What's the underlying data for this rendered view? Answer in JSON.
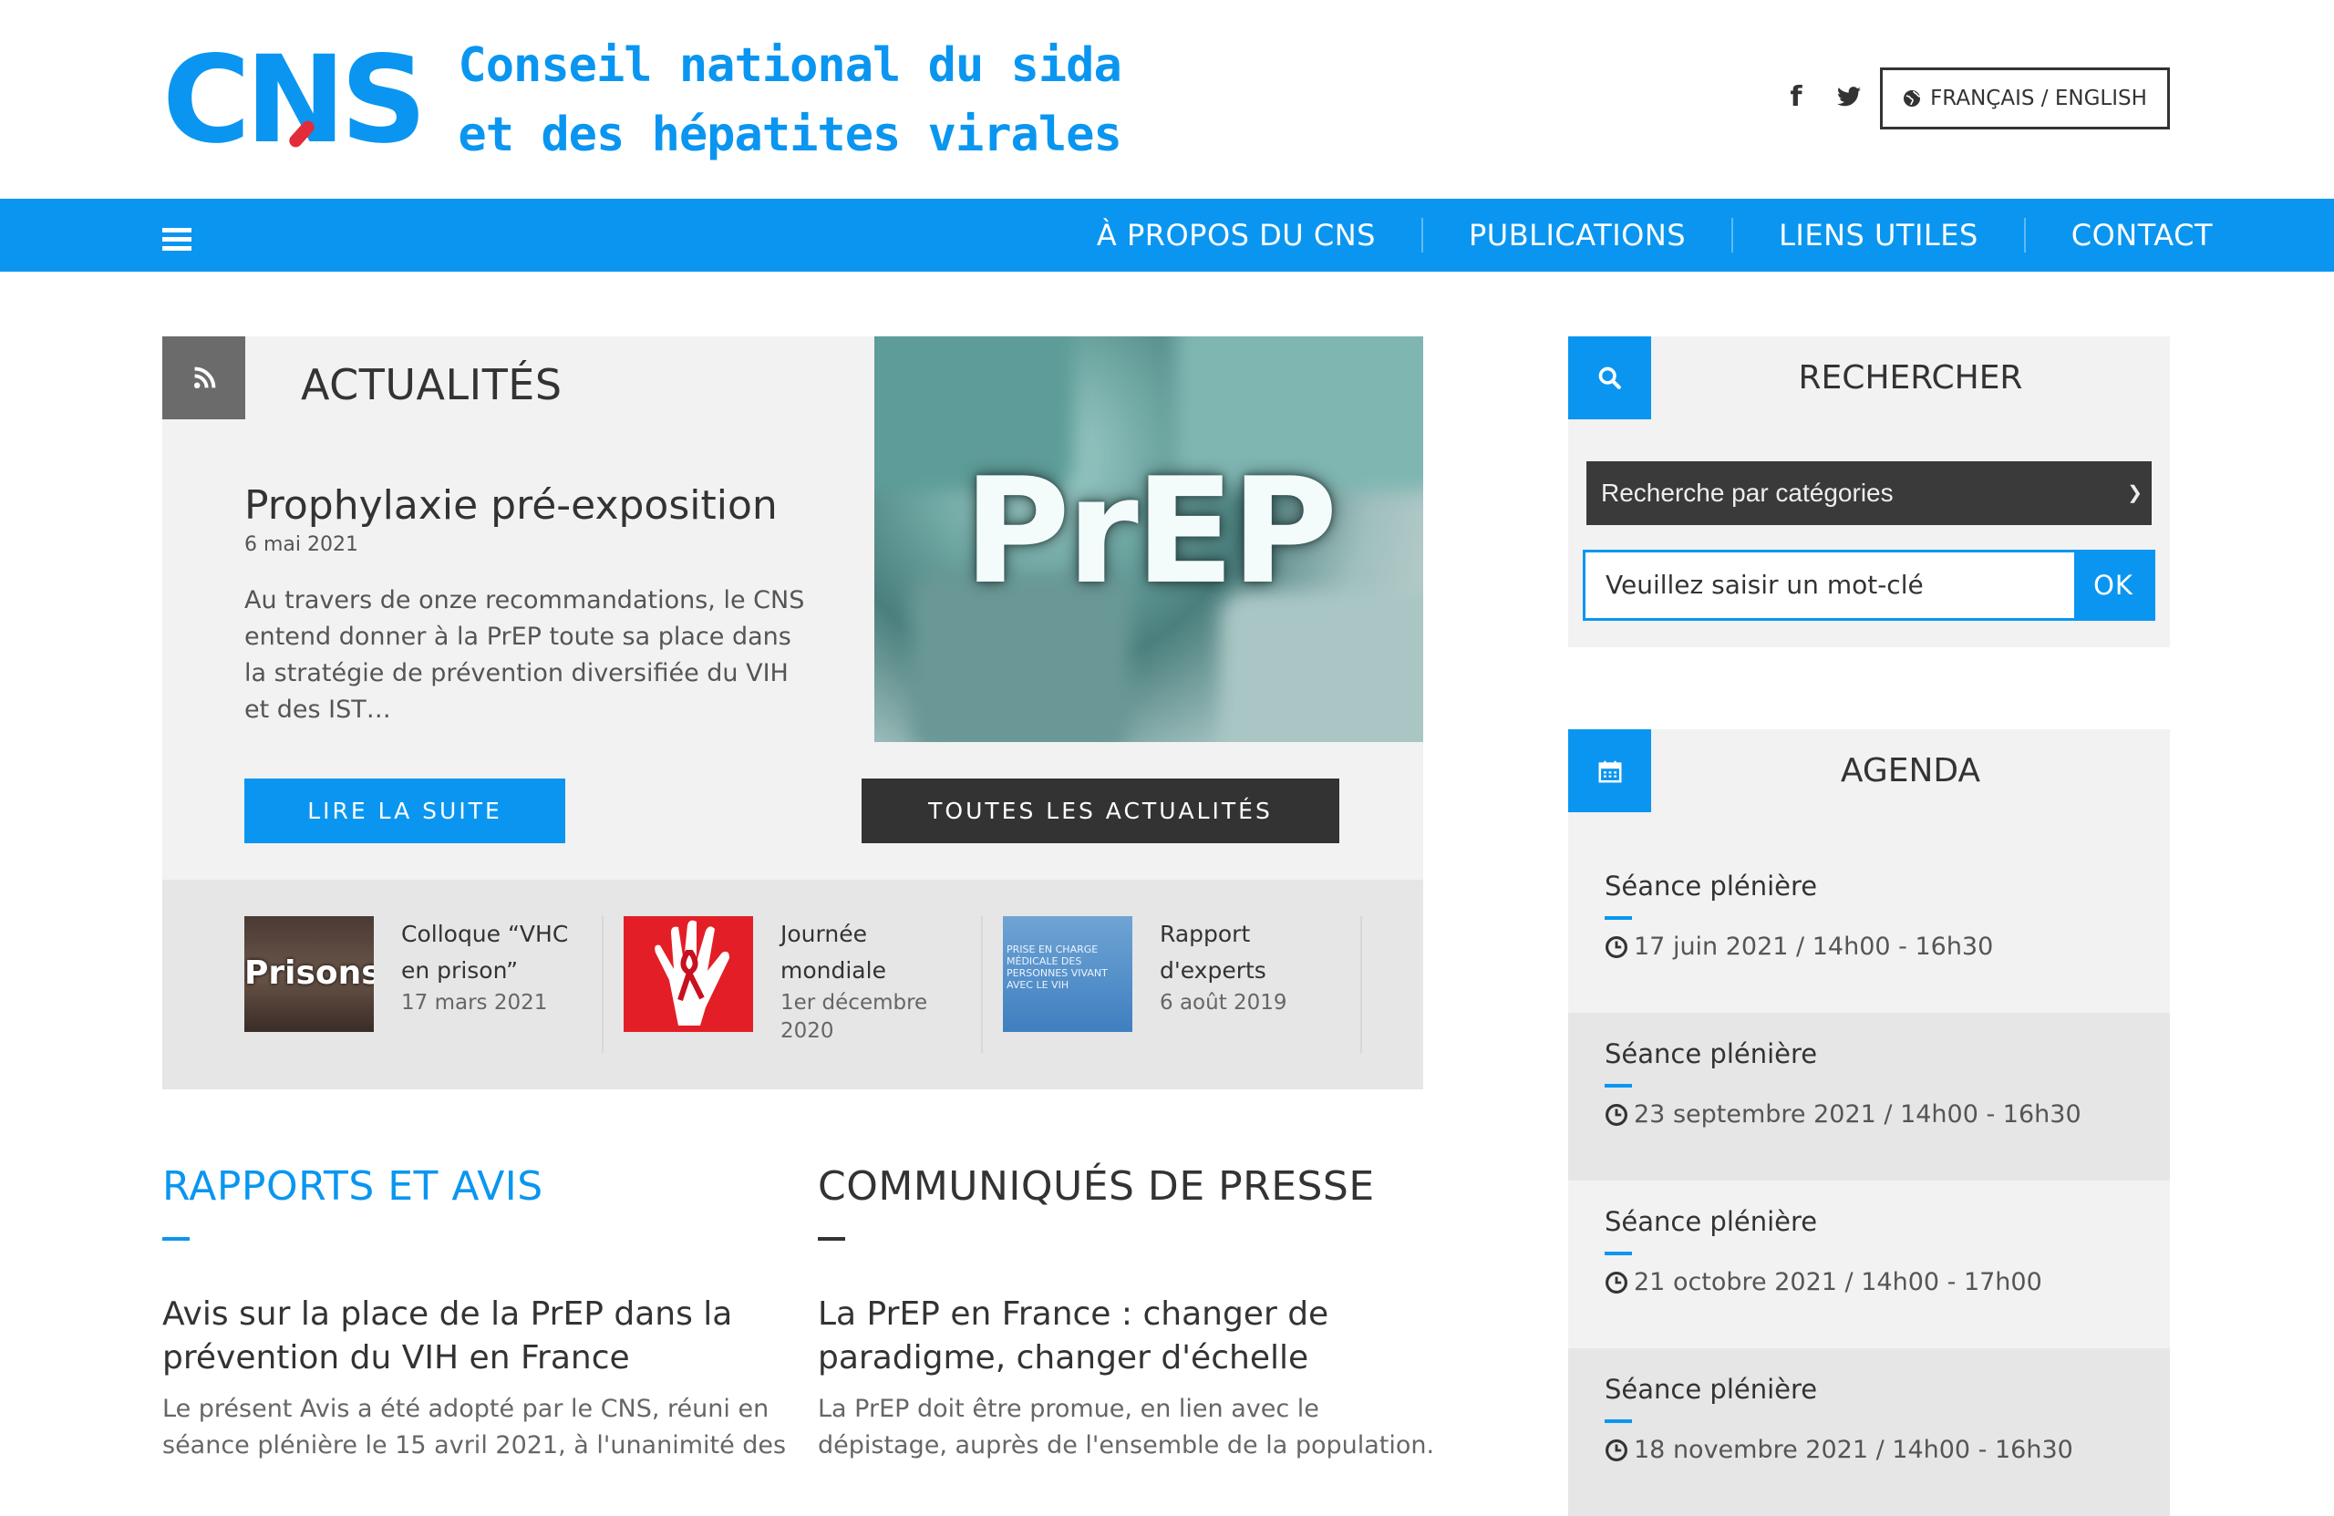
{
  "header": {
    "logo_mark": "CNS",
    "logo_line1": "Conseil national du sida",
    "logo_line2": "et des hépatites virales",
    "language_button": "FRANÇAIS / ENGLISH"
  },
  "nav": {
    "items": [
      "À PROPOS DU CNS",
      "PUBLICATIONS",
      "LIENS UTILES",
      "CONTACT"
    ]
  },
  "news": {
    "section_title": "ACTUALITÉS",
    "featured": {
      "image_text": "PrEP",
      "title": "Prophylaxie pré-exposition",
      "date": "6 mai 2021",
      "excerpt": "Au travers de onze recommandations, le CNS entend donner à la PrEP toute sa place dans la stratégie de prévention diversifiée du VIH et des IST…"
    },
    "read_more": "LIRE LA SUITE",
    "all_news": "TOUTES LES ACTUALITÉS",
    "items": [
      {
        "title": "Colloque “VHC en prison”",
        "date": "17 mars 2021",
        "thumb_text": "Prisons"
      },
      {
        "title": "Journée mondiale",
        "date": "1er décembre 2020",
        "thumb_text": ""
      },
      {
        "title": "Rapport d'experts",
        "date": "6 août 2019",
        "thumb_text": "PRISE EN CHARGE MÉDICALE DES PERSONNES VIVANT AVEC LE VIH"
      }
    ]
  },
  "reports": {
    "heading": "RAPPORTS ET AVIS",
    "title": "Avis sur la place de la PrEP dans la prévention du VIH en France",
    "text": "Le présent Avis a été adopté par le CNS, réuni en séance plénière le 15 avril 2021, à l'unanimité des"
  },
  "press": {
    "heading": "COMMUNIQUÉS DE PRESSE",
    "title": "La PrEP en France : changer de paradigme, changer d'échelle",
    "text": "La PrEP doit être promue, en lien avec le dépistage, auprès de l'ensemble de la population."
  },
  "search": {
    "title": "RECHERCHER",
    "select_value": "Recherche par catégories",
    "placeholder": "Veuillez saisir un mot-clé",
    "ok": "OK"
  },
  "agenda": {
    "title": "AGENDA",
    "items": [
      {
        "title": "Séance plénière",
        "time": "17 juin 2021 / 14h00 - 16h30"
      },
      {
        "title": "Séance plénière",
        "time": "23 septembre 2021 / 14h00 - 16h30"
      },
      {
        "title": "Séance plénière",
        "time": "21 octobre 2021 / 14h00 - 17h00"
      },
      {
        "title": "Séance plénière",
        "time": "18 novembre 2021 / 14h00 - 16h30"
      }
    ]
  },
  "colors": {
    "primary": "#0a96f0",
    "dark": "#333333",
    "panel": "#f2f2f2",
    "panel_alt": "#e6e6e6"
  }
}
